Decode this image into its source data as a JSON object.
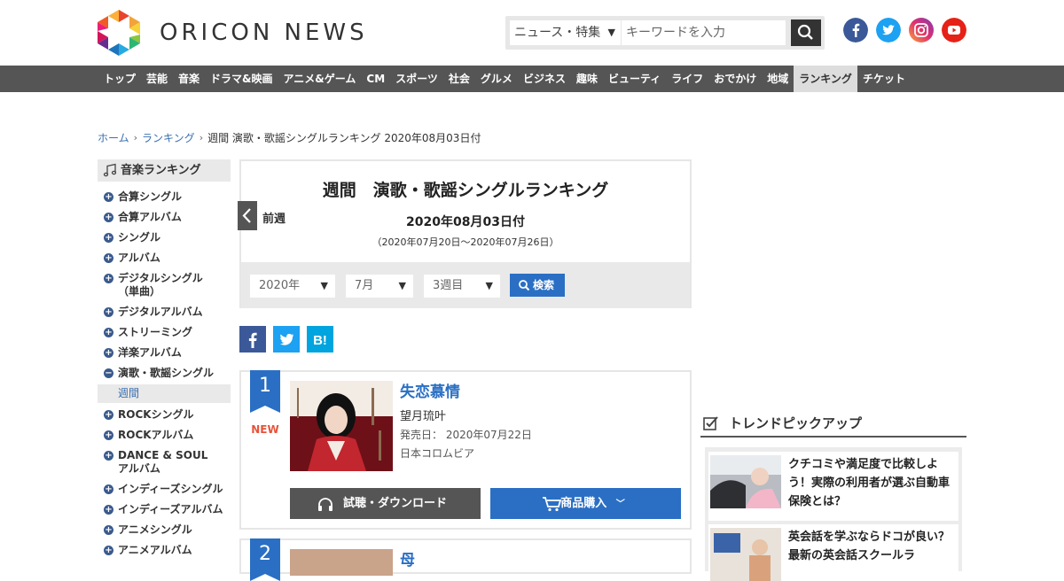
{
  "header": {
    "logo_text": "ORICON NEWS",
    "search_category": "ニュース・特集",
    "search_placeholder": "キーワードを入力"
  },
  "nav": {
    "items": [
      "トップ",
      "芸能",
      "音楽",
      "ドラマ&映画",
      "アニメ&ゲーム",
      "CM",
      "スポーツ",
      "社会",
      "グルメ",
      "ビジネス",
      "趣味",
      "ビューティ",
      "ライフ",
      "おでかけ",
      "地域",
      "ランキング",
      "チケット"
    ],
    "active": "ランキング"
  },
  "breadcrumb": {
    "home": "ホーム",
    "ranking": "ランキング",
    "current": "週間 演歌・歌謡シングルランキング 2020年08月03日付"
  },
  "sidebar": {
    "title": "音楽ランキング",
    "items": [
      {
        "label": "合算シングル",
        "icon": "plus"
      },
      {
        "label": "合算アルバム",
        "icon": "plus"
      },
      {
        "label": "シングル",
        "icon": "plus"
      },
      {
        "label": "アルバム",
        "icon": "plus"
      },
      {
        "label": "デジタルシングル",
        "label2": "（単曲）",
        "icon": "plus"
      },
      {
        "label": "デジタルアルバム",
        "icon": "plus"
      },
      {
        "label": "ストリーミング",
        "icon": "plus"
      },
      {
        "label": "洋楽アルバム",
        "icon": "plus"
      },
      {
        "label": "演歌・歌謡シングル",
        "icon": "minus"
      },
      {
        "label": "ROCKシングル",
        "icon": "plus"
      },
      {
        "label": "ROCKアルバム",
        "icon": "plus"
      },
      {
        "label": "DANCE & SOUL",
        "label2": "アルバム",
        "icon": "plus"
      },
      {
        "label": "インディーズシングル",
        "icon": "plus"
      },
      {
        "label": "インディーズアルバム",
        "icon": "plus"
      },
      {
        "label": "アニメシングル",
        "icon": "plus"
      },
      {
        "label": "アニメアルバム",
        "icon": "plus"
      }
    ],
    "sub_item": "週間"
  },
  "ranking": {
    "title": "週間　演歌・歌謡シングルランキング",
    "date": "2020年08月03日付",
    "range": "（2020年07月20日～2020年07月26日）",
    "prev_label": "前週",
    "year_select": "2020年",
    "month_select": "7月",
    "week_select": "3週目",
    "search_label": "検索"
  },
  "entries": [
    {
      "rank": "1",
      "badge": "NEW",
      "title": "失恋慕情",
      "artist": "望月琉叶",
      "release": "発売日：  2020年07月22日",
      "label": "日本コロムビア",
      "listen_label": "試聴・ダウンロード",
      "buy_label": "商品購入"
    },
    {
      "rank": "2",
      "title": "母"
    }
  ],
  "trend": {
    "title": "トレンドピックアップ",
    "items": [
      "クチコミや満足度で比較しよう！実際の利用者が選ぶ自動車保険とは？",
      "英会話を学ぶならドコが良い？最新の英会話スクールラ"
    ]
  },
  "colors": {
    "nav_bg": "#555555",
    "accent_blue": "#2a6fc4",
    "link_blue": "#3a6fb0",
    "new_red": "#e6533a"
  }
}
